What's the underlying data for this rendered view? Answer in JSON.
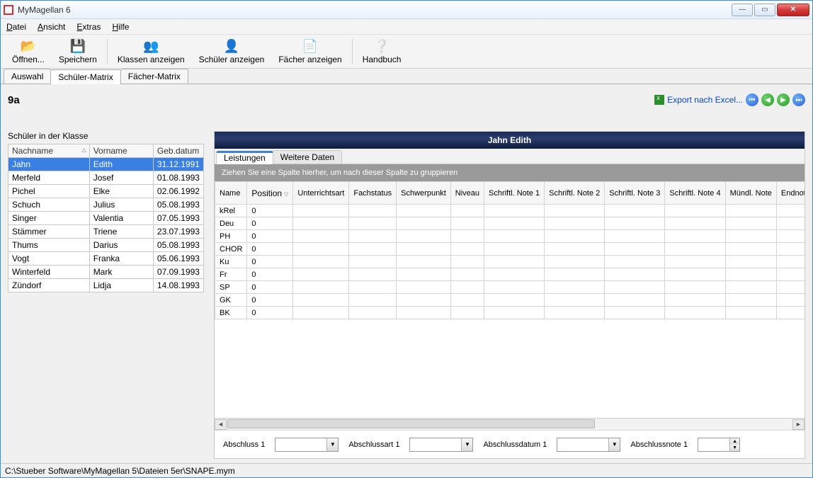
{
  "window": {
    "title": "MyMagellan 6"
  },
  "menu": {
    "file": "Datei",
    "view": "Ansicht",
    "extras": "Extras",
    "help": "Hilfe"
  },
  "toolbar": {
    "open": "Öffnen...",
    "save": "Speichern",
    "classes": "Klassen anzeigen",
    "students": "Schüler anzeigen",
    "subjects": "Fächer anzeigen",
    "handbook": "Handbuch"
  },
  "tabs": {
    "auswahl": "Auswahl",
    "schueler": "Schüler-Matrix",
    "faecher": "Fächer-Matrix"
  },
  "class_name": "9a",
  "export_label": "Export nach Excel...",
  "left_caption": "Schüler in der Klasse",
  "student_cols": {
    "last": "Nachname",
    "first": "Vorname",
    "dob": "Geb.datum"
  },
  "students": [
    {
      "last": "Jahn",
      "first": "Edith",
      "dob": "31.12.1991"
    },
    {
      "last": "Merfeld",
      "first": "Josef",
      "dob": "01.08.1993"
    },
    {
      "last": "Pichel",
      "first": "Elke",
      "dob": "02.06.1992"
    },
    {
      "last": "Schuch",
      "first": "Julius",
      "dob": "05.08.1993"
    },
    {
      "last": "Singer",
      "first": "Valentia",
      "dob": "07.05.1993"
    },
    {
      "last": "Stämmer",
      "first": "Triene",
      "dob": "23.07.1993"
    },
    {
      "last": "Thums",
      "first": "Darius",
      "dob": "05.08.1993"
    },
    {
      "last": "Vogt",
      "first": "Franka",
      "dob": "05.06.1993"
    },
    {
      "last": "Winterfeld",
      "first": "Mark",
      "dob": "07.09.1993"
    },
    {
      "last": "Zündorf",
      "first": "Lidja",
      "dob": "14.08.1993"
    }
  ],
  "selected_student_header": "Jahn Edith",
  "inner_tabs": {
    "leistungen": "Leistungen",
    "weitere": "Weitere Daten"
  },
  "group_hint": "Ziehen Sie eine Spalte hierher, um nach dieser Spalte zu gruppieren",
  "grid_cols": {
    "name": "Name",
    "position": "Position",
    "unterricht": "Unterrichtsart",
    "fachstatus": "Fachstatus",
    "schwerpunkt": "Schwerpunkt",
    "niveau": "Niveau",
    "s1": "Schriftl. Note 1",
    "s2": "Schriftl. Note 2",
    "s3": "Schriftl. Note 3",
    "s4": "Schriftl. Note 4",
    "muendl": "Mündl. Note",
    "end": "Endnote"
  },
  "grid_rows": [
    {
      "name": "kRel",
      "position": "0"
    },
    {
      "name": "Deu",
      "position": "0"
    },
    {
      "name": "PH",
      "position": "0"
    },
    {
      "name": "CHOR",
      "position": "0"
    },
    {
      "name": "Ku",
      "position": "0"
    },
    {
      "name": "Fr",
      "position": "0"
    },
    {
      "name": "SP",
      "position": "0"
    },
    {
      "name": "GK",
      "position": "0"
    },
    {
      "name": "BK",
      "position": "0"
    }
  ],
  "form": {
    "abschluss1": "Abschluss 1",
    "abschlussart1": "Abschlussart 1",
    "abschlussdatum1": "Abschlussdatum 1",
    "abschlussnote1": "Abschlussnote 1"
  },
  "status_path": "C:\\Stueber Software\\MyMagellan 5\\Dateien 5er\\SNAPE.mym"
}
